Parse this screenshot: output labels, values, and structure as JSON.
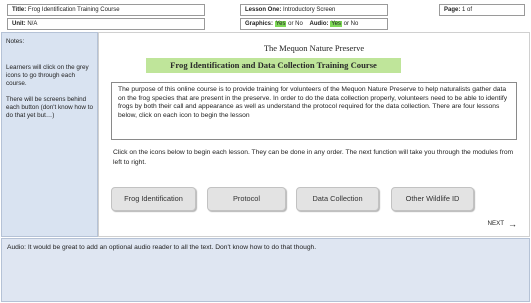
{
  "header": {
    "title_label": "Title:",
    "title_value": "Frog Identification Training Course",
    "lesson_label": "Lesson One:",
    "lesson_value": "Introductory Screen",
    "page_label": "Page:",
    "page_value": "1 of",
    "unit_label": "Unit:",
    "unit_value": "N/A",
    "graphics_label": "Graphics:",
    "graphics_yes": "Yes",
    "graphics_or": "or",
    "graphics_no": "No",
    "audio_label": "Audio:",
    "audio_yes": "Yes",
    "audio_or": "or",
    "audio_no": "No",
    "highlight_color": "#7ed957"
  },
  "notes": {
    "title": "Notes:",
    "para1": "Learners will click on the grey icons to go through each course.",
    "para2": "There will be screens behind each button (don't know how to do that yet but…)"
  },
  "main": {
    "subtitle": "The Mequon Nature Preserve",
    "banner": "Frog Identification and Data Collection Training Course",
    "purpose": "The purpose of this online course is to provide training for volunteers of the Mequon Nature Preserve to help naturalists  gather data on the frog species that are present in the preserve. In order to do the data collection properly, volunteers need to be able to identify frogs by both their call and appearance as well as understand the protocol required for the data collection. There are four lessons below, click on each icon to begin the lesson",
    "instructions": "Click on the icons below to begin each lesson.  They can be done in any order.  The next function will take you through the modules from left to right.",
    "buttons": [
      "Frog Identification",
      "Protocol",
      "Data Collection",
      "Other Wildlife ID"
    ],
    "next_label": "NEXT",
    "next_icon": "arrow-right-icon"
  },
  "audio": {
    "text": "Audio:  It would be great to add an optional audio reader to all the text.  Don't know how to do that though."
  }
}
